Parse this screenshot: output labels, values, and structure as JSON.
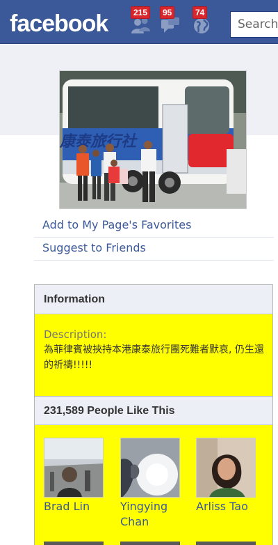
{
  "header": {
    "logo": "facebook",
    "jewels": [
      {
        "icon": "friend-requests-icon",
        "count": "215"
      },
      {
        "icon": "messages-icon",
        "count": "95"
      },
      {
        "icon": "notifications-globe-icon",
        "count": "74"
      }
    ],
    "search_placeholder": "Search"
  },
  "sidebar": {
    "links": [
      {
        "label": "Add to My Page's Favorites"
      },
      {
        "label": "Suggest to Friends"
      }
    ]
  },
  "information": {
    "title": "Information",
    "description_label": "Description:",
    "description_text": "為菲律賓被挾持本港康泰旅行團死難者默哀, 仍生還的祈禱!!!!!"
  },
  "likes": {
    "title": "231,589 People Like This",
    "friends": [
      {
        "name": "Brad Lin"
      },
      {
        "name": "Yingying Chan"
      },
      {
        "name": "Arliss Tao"
      }
    ]
  },
  "colors": {
    "brand": "#3b5998",
    "badge": "#d8262c",
    "highlight": "#ffff00"
  }
}
